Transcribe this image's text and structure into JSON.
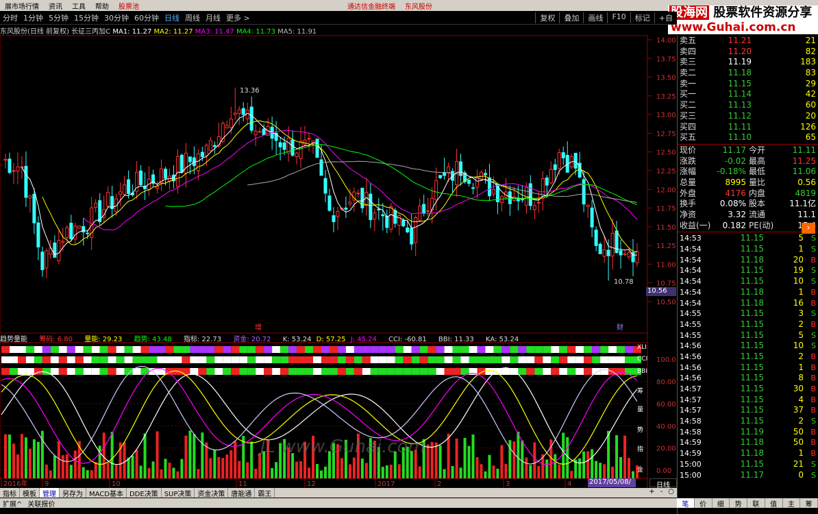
{
  "menu": {
    "items": [
      "展市场行情",
      "资讯",
      "工具",
      "帮助"
    ],
    "stock_pool": "股票池",
    "right1": "通达信金融终端",
    "right2": "东风股份"
  },
  "logo": {
    "line1a": "股海网",
    "line1b": "股票软件资源分享",
    "line2": "www.Guhai.com.cn"
  },
  "periods": [
    "分时",
    "1分钟",
    "5分钟",
    "15分钟",
    "30分钟",
    "60分钟",
    "日线",
    "周线",
    "月线",
    "更多 >"
  ],
  "period_active": "日线",
  "toolbar_right": [
    "复权",
    "叠加",
    "画线",
    "F10",
    "标记",
    "+自"
  ],
  "info": {
    "title": "东风股份(日线 前复权) 长征三丙加C",
    "ma1": "MA1: 11.27",
    "ma2": "MA2: 11.27",
    "ma3": "MA3: 11.47",
    "ma4": "MA4: 11.73",
    "ma5": "MA5: 11.91"
  },
  "price_axis": [
    "14.00",
    "13.75",
    "13.50",
    "13.25",
    "13.00",
    "12.75",
    "12.50",
    "12.25",
    "12.00",
    "11.75",
    "11.50",
    "11.25",
    "11.00",
    "10.75",
    "10.50"
  ],
  "chart_notes": {
    "high": "13.36",
    "low": "10.78",
    "zeng": "增",
    "cai": "财"
  },
  "ind": {
    "name": "趋势量能",
    "chou": "筹码: 6.80",
    "liang": "量能: 29.23",
    "qushi": "趋势: 43.48",
    "zhibiao": "指标: 22.73",
    "zijin": "资金: 20.72",
    "k": "K: 53.24",
    "d": "D: 57.25",
    "j": "J: 45.24",
    "cci": "CCI: -60.81",
    "bbi": "BBI: 11.33",
    "ka": "KA: 53.24"
  },
  "ind_axis": [
    "100.0",
    "80.00",
    "60.00",
    "40.00",
    "20.00",
    "0.00"
  ],
  "ind_tags": [
    "XLI",
    "CCI",
    "BBI",
    "筹",
    "量",
    "势",
    "指",
    "金"
  ],
  "date_axis": [
    "2016年",
    "9",
    "10",
    "11",
    "12",
    "2017",
    "2",
    "3",
    "4"
  ],
  "current_date": "2017/05/08/一",
  "day_tag": "日线",
  "price_tag": "10.56",
  "bottom_tabs": [
    "指标",
    "模板",
    "管理",
    "另存为",
    "MACD基本",
    "DDE决策",
    "SUP决策",
    "资金决策",
    "唐能通",
    "霸王"
  ],
  "bottom_active": "管理",
  "status": [
    "扩展^",
    "关联报价"
  ],
  "zoom": [
    "+",
    "-",
    "○"
  ],
  "watermark": "JL www.Guhai.com",
  "orderbook": [
    {
      "label": "卖五",
      "price": "11.21",
      "vol": "21",
      "pc": "red"
    },
    {
      "label": "卖四",
      "price": "11.20",
      "vol": "82",
      "pc": "red"
    },
    {
      "label": "卖三",
      "price": "11.19",
      "vol": "183",
      "pc": "wht"
    },
    {
      "label": "卖二",
      "price": "11.18",
      "vol": "83",
      "pc": "grn"
    },
    {
      "label": "卖一",
      "price": "11.15",
      "vol": "29",
      "pc": "grn"
    },
    {
      "label": "买一",
      "price": "11.14",
      "vol": "42",
      "pc": "grn"
    },
    {
      "label": "买二",
      "price": "11.13",
      "vol": "60",
      "pc": "grn"
    },
    {
      "label": "买三",
      "price": "11.12",
      "vol": "20",
      "pc": "grn"
    },
    {
      "label": "买四",
      "price": "11.11",
      "vol": "126",
      "pc": "grn"
    },
    {
      "label": "买五",
      "price": "11.10",
      "vol": "65",
      "pc": "grn"
    }
  ],
  "quotes": [
    {
      "a": "现价",
      "b": "11.17",
      "bc": "grn",
      "c": "今开",
      "d": "11.11",
      "dc": "grn"
    },
    {
      "a": "涨跌",
      "b": "-0.02",
      "bc": "grn",
      "c": "最高",
      "d": "11.25",
      "dc": "red"
    },
    {
      "a": "涨幅",
      "b": "-0.18%",
      "bc": "grn",
      "c": "最低",
      "d": "11.06",
      "dc": "grn"
    },
    {
      "a": "总量",
      "b": "8995",
      "bc": "yel",
      "c": "量比",
      "d": "0.56",
      "dc": "yel"
    },
    {
      "a": "外盘",
      "b": "4176",
      "bc": "red",
      "c": "内盘",
      "d": "4819",
      "dc": "grn"
    },
    {
      "a": "换手",
      "b": "0.08%",
      "bc": "wht",
      "c": "股本",
      "d": "11.1亿",
      "dc": "wht"
    },
    {
      "a": "净资",
      "b": "3.32",
      "bc": "wht",
      "c": "流通",
      "d": "11.1",
      "dc": "wht"
    },
    {
      "a": "收益(一)",
      "b": "0.182",
      "bc": "wht",
      "c": "PE(动)",
      "d": "15.4",
      "dc": "wht"
    }
  ],
  "ticks": [
    {
      "t": "14:53",
      "p": "11.15",
      "v": "5",
      "s": "S"
    },
    {
      "t": "14:54",
      "p": "11.15",
      "v": "1",
      "s": "S"
    },
    {
      "t": "14:54",
      "p": "11.18",
      "v": "20",
      "s": "B"
    },
    {
      "t": "14:54",
      "p": "11.15",
      "v": "19",
      "s": "S"
    },
    {
      "t": "14:54",
      "p": "11.15",
      "v": "10",
      "s": "S"
    },
    {
      "t": "14:54",
      "p": "11.18",
      "v": "1",
      "s": "B"
    },
    {
      "t": "14:54",
      "p": "11.18",
      "v": "16",
      "s": "B"
    },
    {
      "t": "14:55",
      "p": "11.15",
      "v": "3",
      "s": "S"
    },
    {
      "t": "14:55",
      "p": "11.15",
      "v": "2",
      "s": "B"
    },
    {
      "t": "14:55",
      "p": "11.15",
      "v": "5",
      "s": "S"
    },
    {
      "t": "14:56",
      "p": "11.15",
      "v": "10",
      "s": "S"
    },
    {
      "t": "14:56",
      "p": "11.15",
      "v": "2",
      "s": "B"
    },
    {
      "t": "14:56",
      "p": "11.15",
      "v": "1",
      "s": "B"
    },
    {
      "t": "14:56",
      "p": "11.15",
      "v": "8",
      "s": "B"
    },
    {
      "t": "14:57",
      "p": "11.15",
      "v": "30",
      "s": "B"
    },
    {
      "t": "14:57",
      "p": "11.15",
      "v": "4",
      "s": "B"
    },
    {
      "t": "14:57",
      "p": "11.15",
      "v": "37",
      "s": "B"
    },
    {
      "t": "14:58",
      "p": "11.15",
      "v": "2",
      "s": "S"
    },
    {
      "t": "14:58",
      "p": "11.19",
      "v": "50",
      "s": "B",
      "pc": "wht"
    },
    {
      "t": "14:59",
      "p": "11.18",
      "v": "50",
      "s": "B"
    },
    {
      "t": "14:59",
      "p": "11.18",
      "v": "1",
      "s": "B"
    },
    {
      "t": "15:00",
      "p": "11.15",
      "v": "21",
      "s": "S"
    },
    {
      "t": "15:00",
      "p": "11.17",
      "v": "0",
      "s": "S"
    }
  ],
  "right_tabs": [
    "笔",
    "价",
    "细",
    "势",
    "联",
    "值",
    "主",
    "筹"
  ],
  "right_active": "笔",
  "chart_data": {
    "type": "candlestick",
    "ylim": [
      10.5,
      14.0
    ],
    "high": 13.36,
    "low": 10.78,
    "last": 11.17,
    "ma": [
      {
        "name": "MA1",
        "value": 11.27,
        "color": "#ffffff"
      },
      {
        "name": "MA2",
        "value": 11.27,
        "color": "#ffff00"
      },
      {
        "name": "MA3",
        "value": 11.47,
        "color": "#ff00ff"
      },
      {
        "name": "MA4",
        "value": 11.73,
        "color": "#00ff00"
      },
      {
        "name": "MA5",
        "value": 11.91,
        "color": "#aaaaaa"
      }
    ]
  }
}
